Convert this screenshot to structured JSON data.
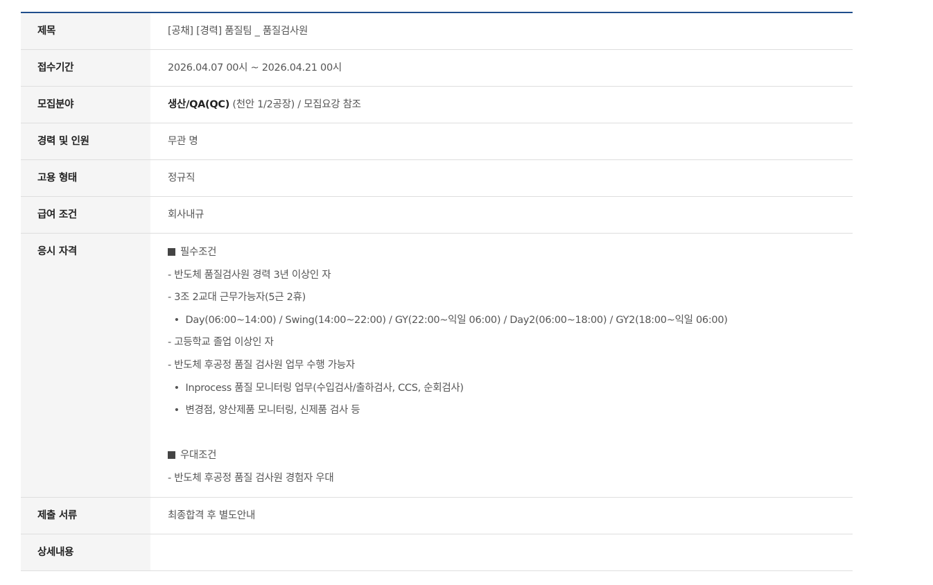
{
  "rows": [
    {
      "label": "제목",
      "value": "[공채] [경력] 품질팀 _ 품질검사원"
    },
    {
      "label": "접수기간",
      "value": "2026.04.07 00시 ~ 2026.04.21 00시"
    },
    {
      "label": "모집분야",
      "value_bold": "생산/QA(QC)",
      "value_rest": " (천안 1/2공장) / 모집요강 참조"
    },
    {
      "label": "경력 및 인원",
      "value": "무관 명"
    },
    {
      "label": "고용 형태",
      "value": "정규직"
    },
    {
      "label": "급여 조건",
      "value": "회사내규"
    },
    {
      "label": "응시 자격",
      "lines": [
        "필수조건",
        "- 반도체 품질검사원 경력 3년 이상인 자",
        "- 3조 2교대 근무가능자(5근 2휴)",
        "  •  Day(06:00~14:00) / Swing(14:00~22:00) / GY(22:00~익일 06:00) / Day2(06:00~18:00) / GY2(18:00~익일 06:00)",
        "- 고등학교 졸업 이상인 자",
        "- 반도체 후공정 품질 검사원 업무 수행 가능자",
        "  •  Inprocess 품질 모니터링 업무(수입검사/출하검사, CCS, 순회검사)",
        "  •  변경점, 양산제품 모니터링, 신제품 검사 등",
        "",
        "우대조건",
        "- 반도체 후공정 품질 검사원 경험자 우대"
      ]
    },
    {
      "label": "제출 서류",
      "value": "최종합격 후 별도안내"
    },
    {
      "label": "상세내용",
      "value": ""
    }
  ]
}
